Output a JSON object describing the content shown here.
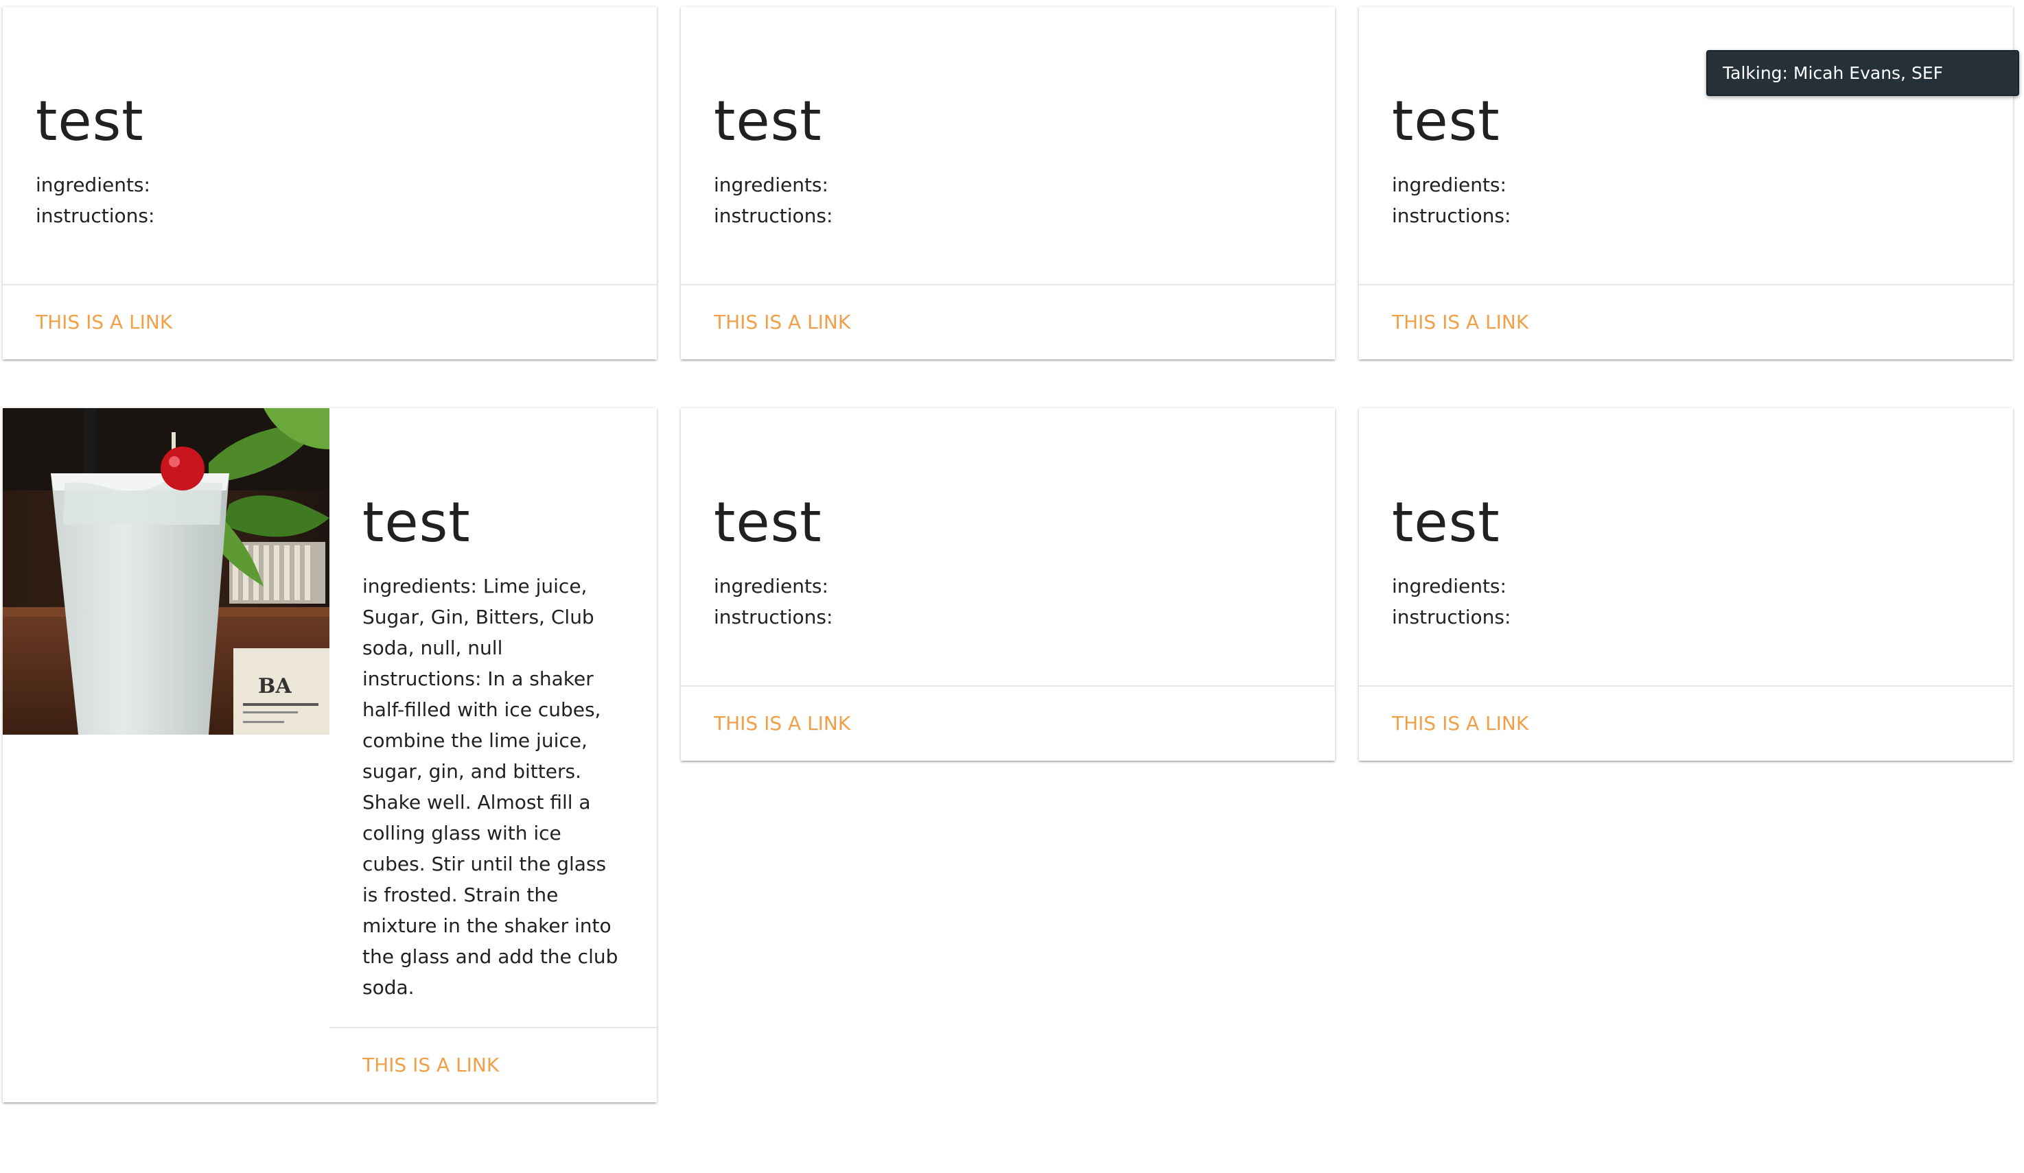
{
  "cards": [
    {
      "title": "test",
      "ingredients": "ingredients:",
      "instructions": "instructions:",
      "link": "THIS IS A LINK"
    },
    {
      "title": "test",
      "ingredients": "ingredients:",
      "instructions": "instructions:",
      "link": "THIS IS A LINK"
    },
    {
      "title": "test",
      "ingredients": "ingredients:",
      "instructions": "instructions:",
      "link": "THIS IS A LINK"
    },
    {
      "title": "test",
      "ingredients": "ingredients: Lime juice, Sugar, Gin, Bitters, Club soda, null, null",
      "instructions": "instructions: In a shaker half-filled with ice cubes, combine the lime juice, sugar, gin, and bitters. Shake well. Almost fill a colling glass with ice cubes. Stir until the glass is frosted. Strain the mixture in the shaker into the glass and add the club soda.",
      "link": "THIS IS A LINK",
      "image_text": "BA"
    },
    {
      "title": "test",
      "ingredients": "ingredients:",
      "instructions": "instructions:",
      "link": "THIS IS A LINK"
    },
    {
      "title": "test",
      "ingredients": "ingredients:",
      "instructions": "instructions:",
      "link": "THIS IS A LINK"
    }
  ],
  "toast": {
    "text": "Talking: Micah Evans, SEF"
  },
  "colors": {
    "link": "#f0a048",
    "toast_bg": "#263039",
    "title": "#212121"
  }
}
